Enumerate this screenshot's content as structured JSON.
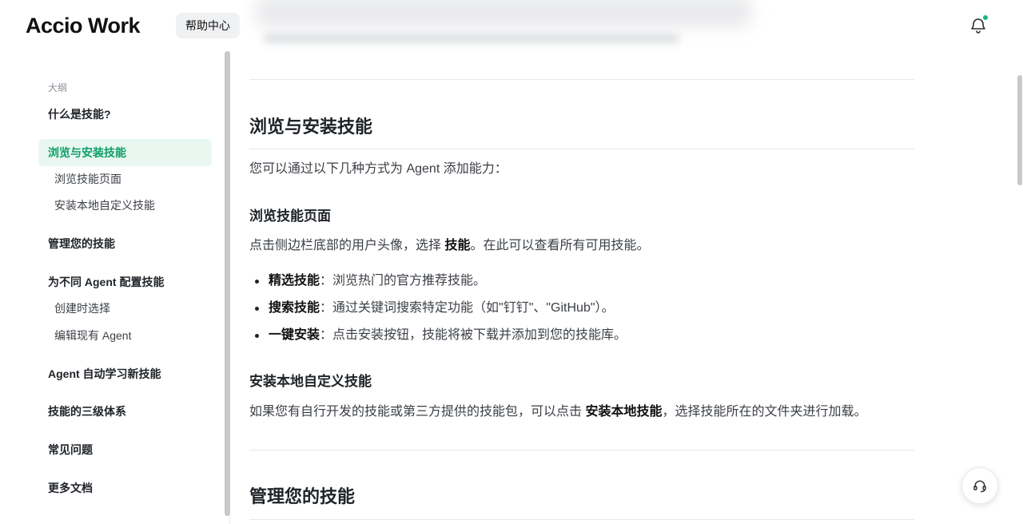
{
  "header": {
    "logo": "Accio Work",
    "help_center": "帮助中心",
    "notification_icon": "bell-icon"
  },
  "sidebar": {
    "outline_label": "大纲",
    "items": [
      {
        "label": "什么是技能?"
      },
      {
        "label": "浏览与安装技能",
        "active": true,
        "children": [
          {
            "label": "浏览技能页面"
          },
          {
            "label": "安装本地自定义技能"
          }
        ]
      },
      {
        "label": "管理您的技能"
      },
      {
        "label": "为不同 Agent 配置技能",
        "children": [
          {
            "label": "创建时选择"
          },
          {
            "label": "编辑现有 Agent"
          }
        ]
      },
      {
        "label": "Agent 自动学习新技能"
      },
      {
        "label": "技能的三级体系"
      },
      {
        "label": "常见问题"
      },
      {
        "label": "更多文档"
      }
    ]
  },
  "content": {
    "section_browse": {
      "title": "浏览与安装技能",
      "intro": "您可以通过以下几种方式为 Agent 添加能力：",
      "browse_page": {
        "title": "浏览技能页面",
        "text_before": "点击侧边栏底部的用户头像，选择 ",
        "text_bold": "技能",
        "text_after": "。在此可以查看所有可用技能。",
        "bullets": [
          {
            "bold": "精选技能",
            "text": "：浏览热门的官方推荐技能。"
          },
          {
            "bold": "搜索技能",
            "text": "：通过关键词搜索特定功能（如\"钉钉\"、\"GitHub\"）。"
          },
          {
            "bold": "一键安装",
            "text": "：点击安装按钮，技能将被下载并添加到您的技能库。"
          }
        ]
      },
      "install_local": {
        "title": "安装本地自定义技能",
        "text_before": "如果您有自行开发的技能或第三方提供的技能包，可以点击 ",
        "text_bold": "安装本地技能",
        "text_after": "，选择技能所在的文件夹进行加载。"
      }
    },
    "section_manage": {
      "title": "管理您的技能"
    }
  },
  "support": {
    "icon": "headset-icon"
  },
  "colors": {
    "accent": "#0f9d6b",
    "accent_bg": "#e9f7f1",
    "notification_dot": "#19b580"
  }
}
